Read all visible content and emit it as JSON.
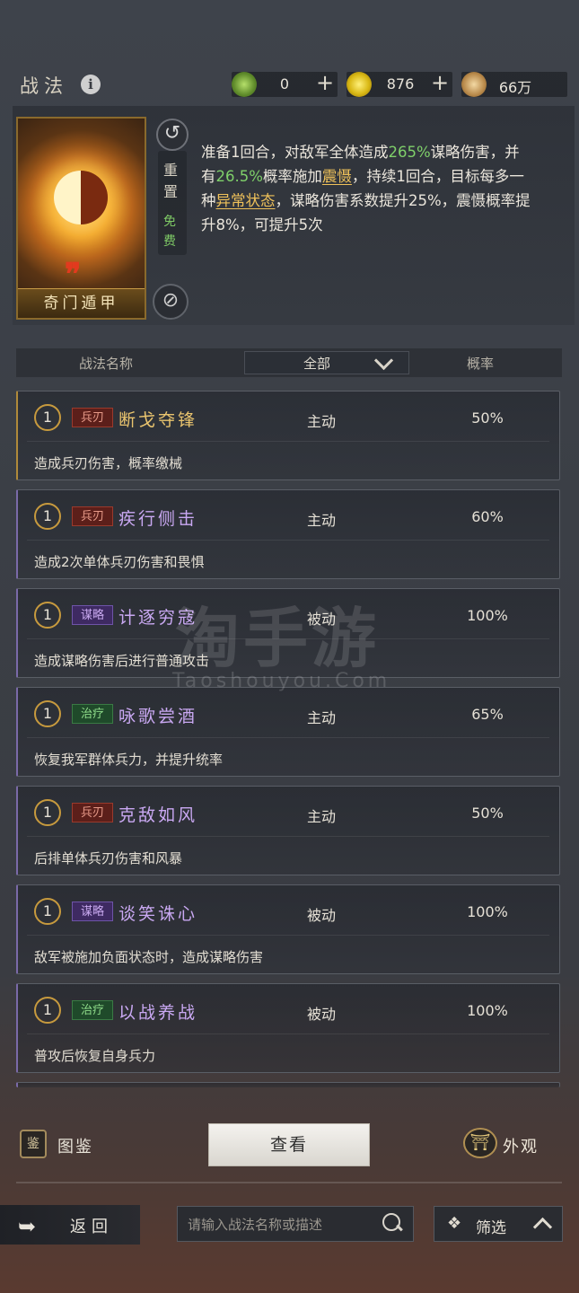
{
  "header": {
    "title": "战法",
    "info_icon": "info-icon",
    "resources": [
      {
        "icon": "jade-icon",
        "value": "0"
      },
      {
        "icon": "gold-icon",
        "value": "876"
      },
      {
        "icon": "coin-icon",
        "value": "66万"
      }
    ],
    "plus": "+"
  },
  "skill_card": {
    "name": "奇门遁甲",
    "reset_label": "重置",
    "free_label": "免费",
    "description": {
      "p1": "准备1回合，对敌军全体造成",
      "v1": "265%",
      "p2": "谋略伤害，并有",
      "v2": "26.5%",
      "p3": "概率施加",
      "k1": "震慑",
      "p4": "，持续1回合，目标每多一种",
      "k2": "异常状态",
      "p5": "，谋略伤害系数提升25%，震慑概率提升8%，可提升5次"
    }
  },
  "table_header": {
    "name_col": "战法名称",
    "filter_value": "全部",
    "rate_col": "概率"
  },
  "skills": [
    {
      "level": "1",
      "tag": "兵刃",
      "name": "断戈夺锋",
      "type": "主动",
      "rate": "50%",
      "desc": "造成兵刃伤害，概率缴械"
    },
    {
      "level": "1",
      "tag": "兵刃",
      "name": "疾行侧击",
      "type": "主动",
      "rate": "60%",
      "desc": "造成2次单体兵刃伤害和畏惧"
    },
    {
      "level": "1",
      "tag": "谋略",
      "name": "计逐穷寇",
      "type": "被动",
      "rate": "100%",
      "desc": "造成谋略伤害后进行普通攻击"
    },
    {
      "level": "1",
      "tag": "治疗",
      "name": "咏歌尝酒",
      "type": "主动",
      "rate": "65%",
      "desc": "恢复我军群体兵力，并提升统率"
    },
    {
      "level": "1",
      "tag": "兵刃",
      "name": "克敌如风",
      "type": "主动",
      "rate": "50%",
      "desc": "后排单体兵刃伤害和风暴"
    },
    {
      "level": "1",
      "tag": "谋略",
      "name": "谈笑诛心",
      "type": "被动",
      "rate": "100%",
      "desc": "敌军被施加负面状态时，造成谋略伤害"
    },
    {
      "level": "1",
      "tag": "治疗",
      "name": "以战养战",
      "type": "被动",
      "rate": "100%",
      "desc": "普攻后恢复自身兵力"
    }
  ],
  "watermark": {
    "cn": "淘手游",
    "en": "Taoshouyou.Com"
  },
  "bottom": {
    "codex_label": "图鉴",
    "codex_icon_text": "鉴",
    "view_button": "查看",
    "appearance_label": "外观",
    "back_label": "返回",
    "search_placeholder": "请输入战法名称或描述",
    "filter_label": "筛选"
  }
}
